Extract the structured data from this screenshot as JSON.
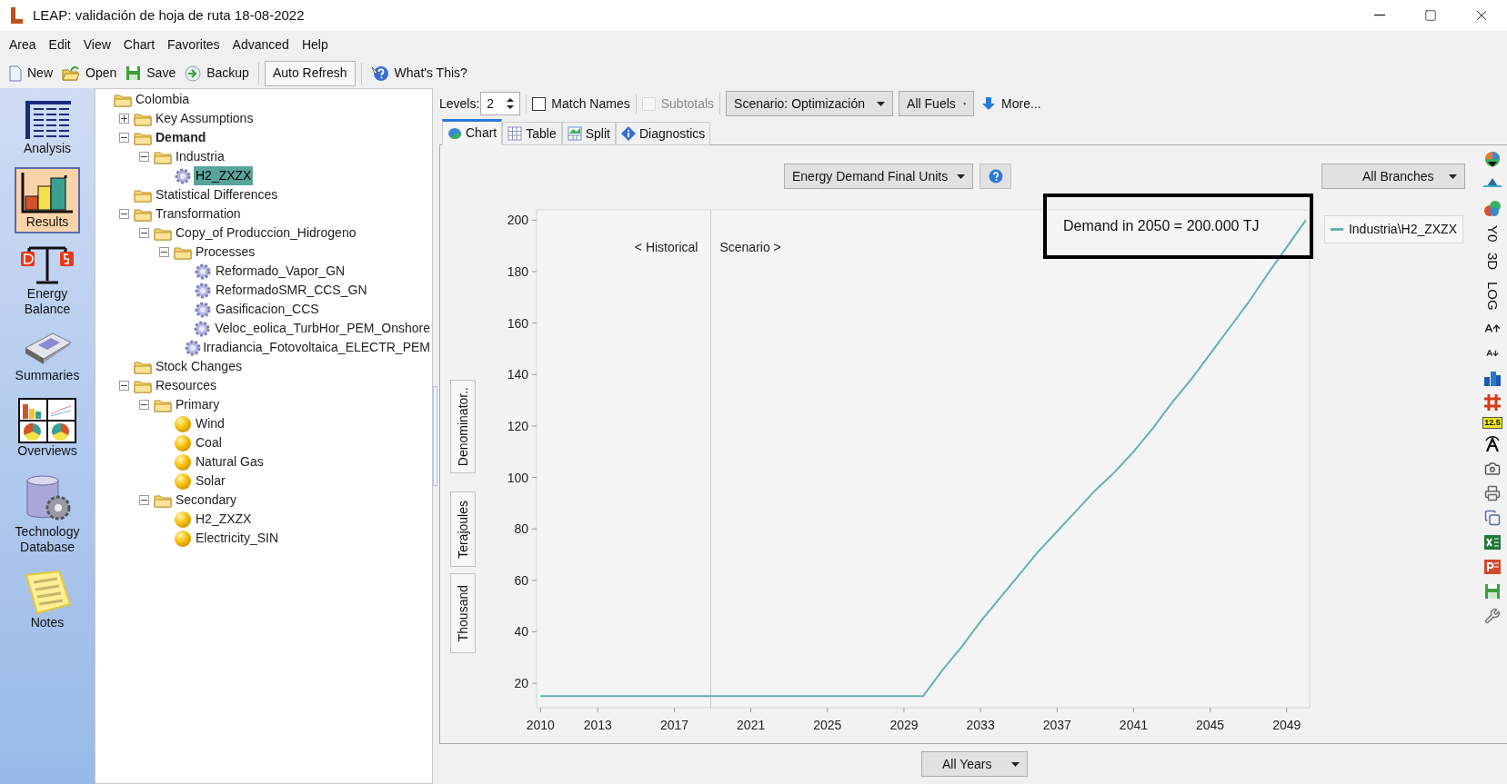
{
  "window": {
    "title": "LEAP: validación de hoja de ruta 18-08-2022"
  },
  "menu": [
    "Area",
    "Edit",
    "View",
    "Chart",
    "Favorites",
    "Advanced",
    "Help"
  ],
  "toolbar": [
    {
      "kind": "new",
      "label": "New"
    },
    {
      "kind": "open",
      "label": "Open"
    },
    {
      "kind": "save",
      "label": "Save"
    },
    {
      "kind": "backup",
      "label": "Backup"
    },
    {
      "kind": "toggle",
      "label": "Auto Refresh",
      "pressed": true
    },
    {
      "kind": "help",
      "label": "What's This?"
    }
  ],
  "views": [
    {
      "kind": "analysis",
      "label": "Analysis",
      "selected": false
    },
    {
      "kind": "results",
      "label": "Results",
      "selected": true
    },
    {
      "kind": "balance",
      "label": "Energy Balance",
      "selected": false
    },
    {
      "kind": "summaries",
      "label": "Summaries",
      "selected": false
    },
    {
      "kind": "overviews",
      "label": "Overviews",
      "selected": false
    },
    {
      "kind": "database",
      "label": "Technology Database",
      "selected": false
    },
    {
      "kind": "notes",
      "label": "Notes",
      "selected": false
    }
  ],
  "tree": {
    "label": "Colombia",
    "kind": "folder",
    "selected": false,
    "children": [
      {
        "label": "Key Assumptions",
        "kind": "folder",
        "expanded": false,
        "bold": false,
        "selected": false
      },
      {
        "label": "Demand",
        "kind": "folder",
        "expanded": true,
        "bold": true,
        "selected": false,
        "children": [
          {
            "label": "Industria",
            "kind": "folder",
            "expanded": true,
            "selected": false,
            "children": [
              {
                "label": "H2_ZXZX",
                "kind": "process",
                "selected": true
              }
            ]
          }
        ]
      },
      {
        "label": "Statistical Differences",
        "kind": "folder",
        "bold": false,
        "selected": false
      },
      {
        "label": "Transformation",
        "kind": "folder",
        "expanded": true,
        "bold": false,
        "selected": false,
        "children": [
          {
            "label": "Copy_of Produccion_Hidrogeno",
            "kind": "folder",
            "expanded": true,
            "selected": false,
            "children": [
              {
                "label": "Processes",
                "kind": "folder",
                "expanded": true,
                "selected": false,
                "children": [
                  {
                    "label": "Reformado_Vapor_GN",
                    "kind": "process",
                    "selected": false
                  },
                  {
                    "label": "ReformadoSMR_CCS_GN",
                    "kind": "process",
                    "selected": false
                  },
                  {
                    "label": "Gasificacion_CCS",
                    "kind": "process",
                    "selected": false
                  },
                  {
                    "label": "Veloc_eolica_TurbHor_PEM_Onshore",
                    "kind": "process",
                    "selected": false
                  },
                  {
                    "label": "Irradiancia_Fotovoltaica_ELECTR_PEM",
                    "kind": "process",
                    "selected": false
                  }
                ]
              }
            ]
          }
        ]
      },
      {
        "label": "Stock Changes",
        "kind": "folder",
        "bold": false,
        "selected": false
      },
      {
        "label": "Resources",
        "kind": "folder",
        "expanded": true,
        "bold": false,
        "selected": false,
        "children": [
          {
            "label": "Primary",
            "kind": "folder",
            "expanded": true,
            "selected": false,
            "children": [
              {
                "label": "Wind",
                "kind": "resource",
                "selected": false
              },
              {
                "label": "Coal",
                "kind": "resource",
                "selected": false
              },
              {
                "label": "Natural Gas",
                "kind": "resource",
                "selected": false
              },
              {
                "label": "Solar",
                "kind": "resource",
                "selected": false
              }
            ]
          },
          {
            "label": "Secondary",
            "kind": "folder",
            "expanded": true,
            "selected": false,
            "children": [
              {
                "label": "H2_ZXZX",
                "kind": "resource",
                "selected": false
              },
              {
                "label": "Electricity_SIN",
                "kind": "resource",
                "selected": false
              }
            ]
          }
        ]
      }
    ]
  },
  "controls": {
    "levels_label": "Levels:",
    "levels_value": "2",
    "match_names": {
      "label": "Match Names",
      "checked": false,
      "disabled": false
    },
    "subtotals": {
      "label": "Subtotals",
      "checked": false,
      "disabled": true
    },
    "scenario": "Scenario: Optimización",
    "fuels": "All Fuels",
    "more": "More..."
  },
  "tabs": [
    {
      "kind": "chart",
      "label": "Chart",
      "selected": true
    },
    {
      "kind": "table",
      "label": "Table",
      "selected": false
    },
    {
      "kind": "split",
      "label": "Split",
      "selected": false
    },
    {
      "kind": "diagnostics",
      "label": "Diagnostics",
      "selected": false
    }
  ],
  "variable": "Energy Demand Final Units",
  "branches": "All Branches",
  "axis_buttons": [
    "Denominator..",
    "Terajoules",
    "Thousand"
  ],
  "annotation_box": "Demand in 2050 = 200.000 TJ",
  "period_labels": {
    "historical": "< Historical",
    "scenario": "Scenario >"
  },
  "side_tool_texts": [
    "Y0",
    "3D",
    "LOG",
    "12.5"
  ],
  "years": "All Years",
  "chart": {
    "chart_data": {
      "type": "line",
      "x": [
        2010,
        2011,
        2012,
        2013,
        2014,
        2015,
        2016,
        2017,
        2018,
        2019,
        2020,
        2021,
        2022,
        2023,
        2024,
        2025,
        2026,
        2027,
        2028,
        2029,
        2030,
        2031,
        2032,
        2033,
        2034,
        2035,
        2036,
        2037,
        2038,
        2039,
        2040,
        2041,
        2042,
        2043,
        2044,
        2045,
        2046,
        2047,
        2048,
        2049,
        2050
      ],
      "series": [
        {
          "name": "Industria\\H2_ZXZX",
          "color": "#5fb3aa",
          "values": [
            15,
            15,
            15,
            15,
            15,
            15,
            15,
            15,
            15,
            15,
            15,
            15,
            15,
            15,
            15,
            15,
            15,
            15,
            15,
            15,
            15,
            25,
            34,
            44,
            53,
            62,
            71,
            79,
            87,
            95,
            102,
            110,
            119,
            129,
            138,
            148,
            158,
            168,
            179,
            189.5,
            200
          ]
        }
      ],
      "xlim": [
        2009.8,
        2050.2
      ],
      "ylim": [
        10.5,
        204
      ],
      "xticks": [
        2010,
        2013,
        2017,
        2021,
        2025,
        2029,
        2033,
        2037,
        2041,
        2045,
        2049
      ],
      "yticks": [
        20,
        40,
        60,
        80,
        100,
        120,
        140,
        160,
        180,
        200
      ],
      "ref_lines": [
        {
          "axis": "x",
          "value": 2018.9,
          "color": "#c8c8c8"
        }
      ]
    }
  }
}
